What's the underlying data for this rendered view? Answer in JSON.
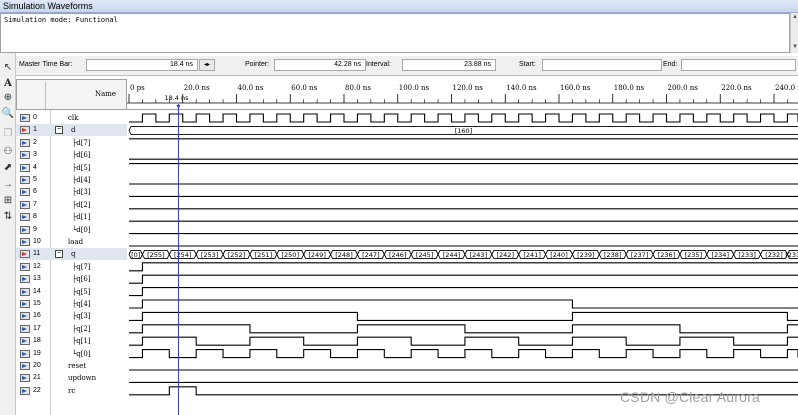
{
  "window": {
    "title": "Simulation Waveforms",
    "mode_text": "Simulation mode: Functional"
  },
  "timebar": {
    "master_label": "Master Time Bar:",
    "master_value": "18.4 ns",
    "pointer_label": "Pointer:",
    "pointer_value": "42.28 ns",
    "interval_label": "Interval:",
    "interval_value": "23.88 ns",
    "start_label": "Start:",
    "start_value": "",
    "end_label": "End:",
    "end_value": ""
  },
  "name_header": "Name",
  "ruler": {
    "ticks": [
      "0 ps",
      "20.0 ns",
      "40.0 ns",
      "60.0 ns",
      "80.0 ns",
      "100.0 ns",
      "120.0 ns",
      "140.0 ns",
      "160.0 ns",
      "180.0 ns",
      "200.0 ns",
      "220.0 ns",
      "240.0 ns"
    ],
    "cursor_label": "18.4 ns"
  },
  "toolbar_icons": [
    "pointer-icon",
    "text-tool-icon",
    "zoom-fit-icon",
    "zoom-icon",
    "binoculars-find-icon",
    "find-next-icon",
    "arrow-right-icon",
    "group-icon",
    "sort-icon"
  ],
  "signals": [
    {
      "idx": "0",
      "name": "clk",
      "group": false
    },
    {
      "idx": "1",
      "name": "d",
      "group": true
    },
    {
      "idx": "2",
      "name": "d[7]",
      "child": true
    },
    {
      "idx": "3",
      "name": "d[6]",
      "child": true
    },
    {
      "idx": "4",
      "name": "d[5]",
      "child": true
    },
    {
      "idx": "5",
      "name": "d[4]",
      "child": true
    },
    {
      "idx": "6",
      "name": "d[3]",
      "child": true
    },
    {
      "idx": "7",
      "name": "d[2]",
      "child": true
    },
    {
      "idx": "8",
      "name": "d[1]",
      "child": true
    },
    {
      "idx": "9",
      "name": "d[0]",
      "child": true,
      "last": true
    },
    {
      "idx": "10",
      "name": "load",
      "group": false
    },
    {
      "idx": "11",
      "name": "q",
      "group": true
    },
    {
      "idx": "12",
      "name": "q[7]",
      "child": true
    },
    {
      "idx": "13",
      "name": "q[6]",
      "child": true
    },
    {
      "idx": "14",
      "name": "q[5]",
      "child": true
    },
    {
      "idx": "15",
      "name": "q[4]",
      "child": true
    },
    {
      "idx": "16",
      "name": "q[3]",
      "child": true
    },
    {
      "idx": "17",
      "name": "q[2]",
      "child": true
    },
    {
      "idx": "18",
      "name": "q[1]",
      "child": true
    },
    {
      "idx": "19",
      "name": "q[0]",
      "child": true,
      "last": true
    },
    {
      "idx": "20",
      "name": "reset",
      "group": false
    },
    {
      "idx": "21",
      "name": "updown",
      "group": false
    },
    {
      "idx": "22",
      "name": "rc",
      "group": false
    }
  ],
  "d_bus_value": "[160]",
  "q_bus_values": [
    "[0]",
    "[255]",
    "[254]",
    "[253]",
    "[252]",
    "[251]",
    "[250]",
    "[249]",
    "[248]",
    "[247]",
    "[246]",
    "[245]",
    "[244]",
    "[243]",
    "[242]",
    "[241]",
    "[240]",
    "[239]",
    "[238]",
    "[237]",
    "[236]",
    "[235]",
    "[234]",
    "[233]",
    "[232]",
    "[231"
  ],
  "watermark": "CSDN @Clear Aurora",
  "colors": {
    "cursor": "#3040c8",
    "wave": "#000000",
    "selected_row": "#dfe6f0"
  }
}
